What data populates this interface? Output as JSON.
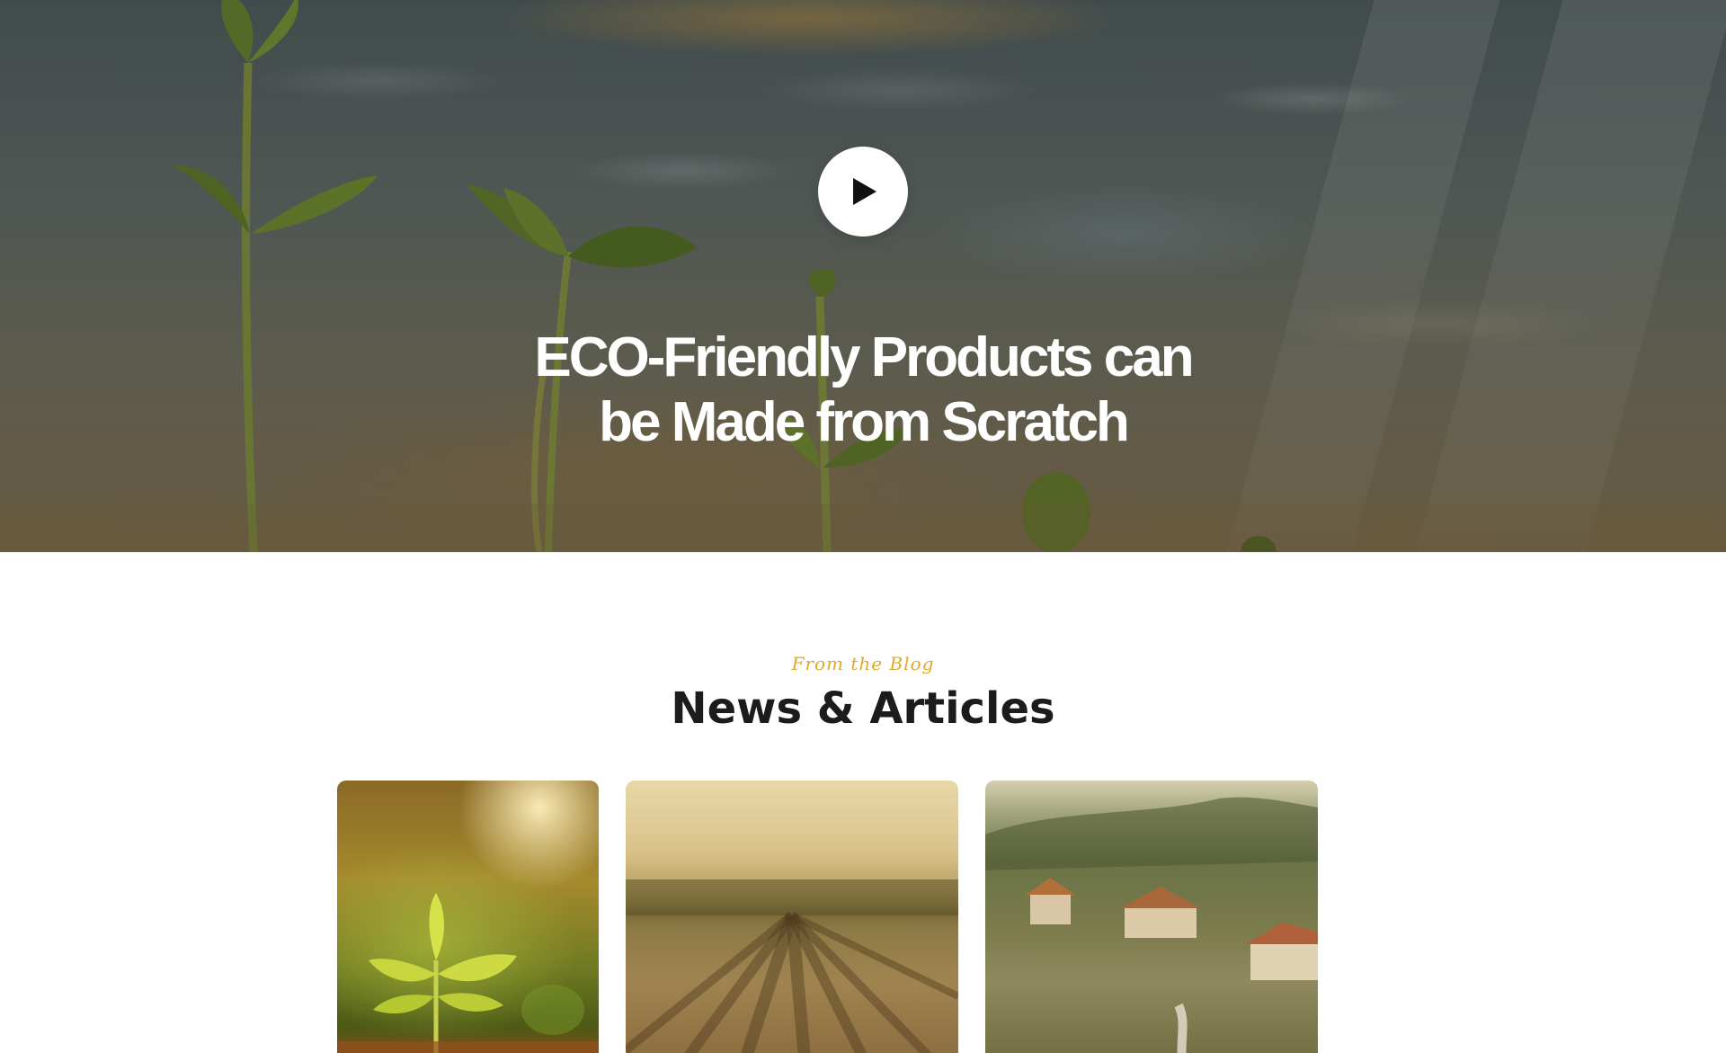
{
  "hero": {
    "title_line1": "ECO-Friendly Products can",
    "title_line2": "be Made from Scratch",
    "play_icon": "play-icon"
  },
  "blog": {
    "kicker": "From the Blog",
    "title": "News & Articles",
    "cards": [
      {
        "image": "seedling-sunlight-image"
      },
      {
        "image": "crop-field-rows-image"
      },
      {
        "image": "countryside-village-image"
      }
    ]
  },
  "colors": {
    "kicker": "#e0a92c",
    "heading": "#1c1c1c",
    "hero_text": "#ffffff",
    "play_button": "#ffffff"
  }
}
